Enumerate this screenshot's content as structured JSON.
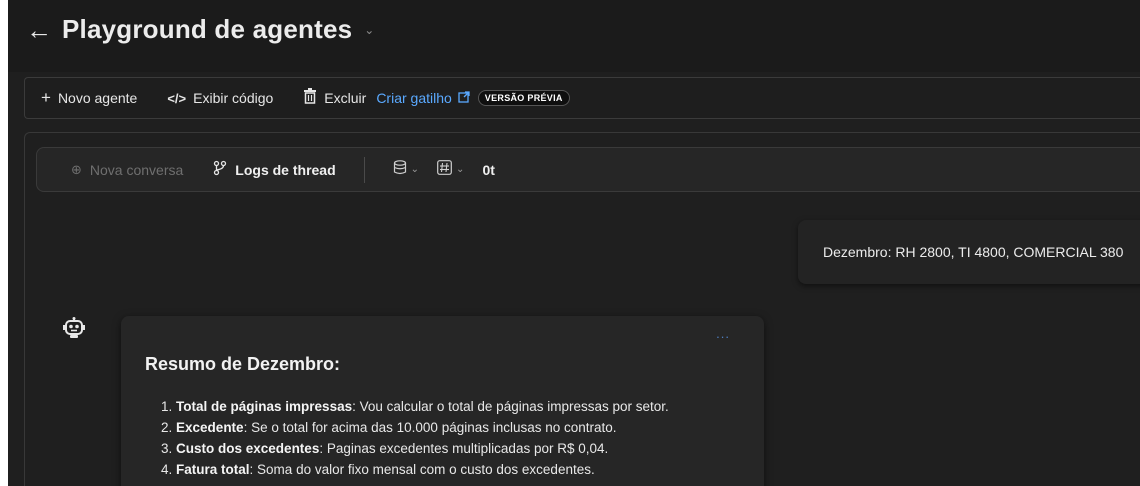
{
  "header": {
    "back_icon": "arrow-left-icon",
    "title": "Playground de agentes",
    "title_dropdown_icon": "chevron-down-icon"
  },
  "toolbar": {
    "new_agent": "Novo agente",
    "view_code": "Exibir código",
    "delete": "Excluir",
    "create_trigger": "Criar gatilho",
    "preview_badge": "VERSÃO PRÉVIA"
  },
  "subtoolbar": {
    "new_conversation": "Nova conversa",
    "thread_logs": "Logs de thread",
    "token_count": "0t"
  },
  "chat": {
    "user_message": "Dezembro: RH 2800, TI 4800, COMERCIAL 380",
    "bot": {
      "more_label": "...",
      "heading": "Resumo de Dezembro:",
      "items": [
        {
          "num": "1.",
          "label": "Total de páginas impressas",
          "text": ": Vou calcular o total de páginas impressas por setor."
        },
        {
          "num": "2.",
          "label": "Excedente",
          "text": ": Se o total for acima das 10.000 páginas inclusas no contrato."
        },
        {
          "num": "3.",
          "label": "Custo dos excedentes",
          "text": ": Paginas excedentes multiplicadas por R$ 0,04."
        },
        {
          "num": "4.",
          "label": "Fatura total",
          "text": ": Soma do valor fixo mensal com o custo dos excedentes."
        }
      ]
    }
  },
  "colors": {
    "background": "#1f1f1f",
    "link": "#5aa9ff",
    "card": "#262626"
  }
}
